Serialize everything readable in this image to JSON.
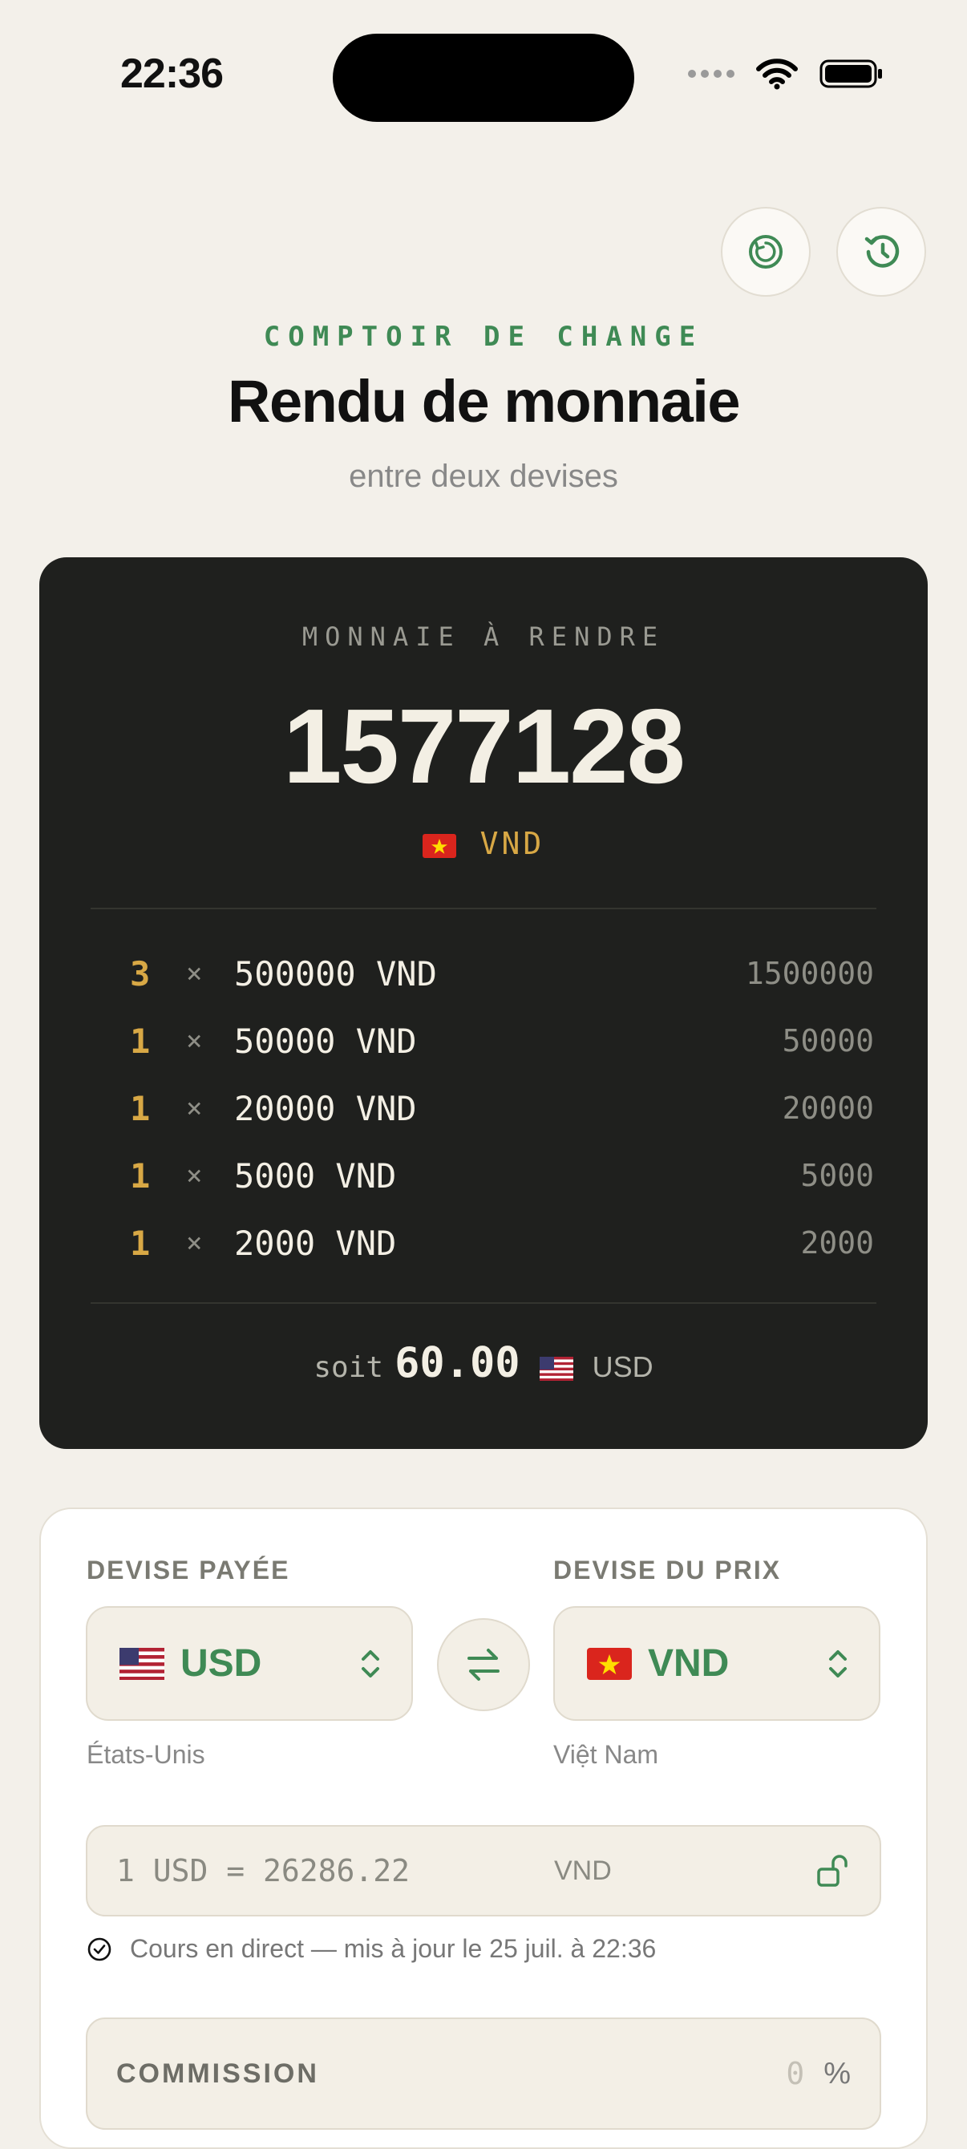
{
  "status_bar": {
    "time": "22:36"
  },
  "header": {
    "eyebrow": "COMPTOIR DE CHANGE",
    "title": "Rendu de monnaie",
    "subtitle": "entre deux devises"
  },
  "result": {
    "label": "MONNAIE À RENDRE",
    "amount": "1577128",
    "currency_code": "VND",
    "currency_flag": "vn-flag",
    "breakdown": [
      {
        "count": "3",
        "times": "×",
        "denomination": "500000 VND",
        "total": "1500000"
      },
      {
        "count": "1",
        "times": "×",
        "denomination": "50000 VND",
        "total": "50000"
      },
      {
        "count": "1",
        "times": "×",
        "denomination": "20000 VND",
        "total": "20000"
      },
      {
        "count": "1",
        "times": "×",
        "denomination": "5000 VND",
        "total": "5000"
      },
      {
        "count": "1",
        "times": "×",
        "denomination": "2000 VND",
        "total": "2000"
      }
    ],
    "equivalent": {
      "prefix": "soit",
      "amount": "60.00",
      "currency_code": "USD",
      "currency_flag": "us-flag"
    }
  },
  "form": {
    "paid": {
      "label": "DEVISE PAYÉE",
      "code": "USD",
      "flag": "us-flag",
      "country": "États-Unis"
    },
    "price": {
      "label": "DEVISE DU PRIX",
      "code": "VND",
      "flag": "vn-flag",
      "country": "Việt Nam"
    },
    "rate": {
      "text": "1 USD = 26286.22",
      "to": "VND"
    },
    "live_note": "Cours en direct — mis à jour le 25 juil. à 22:36",
    "commission": {
      "label": "COMMISSION",
      "value": "0",
      "unit": "%"
    }
  },
  "colors": {
    "accent": "#3f8a55",
    "gold": "#d8a845",
    "card_dark": "#1f201e",
    "background": "#f3f0ea"
  }
}
